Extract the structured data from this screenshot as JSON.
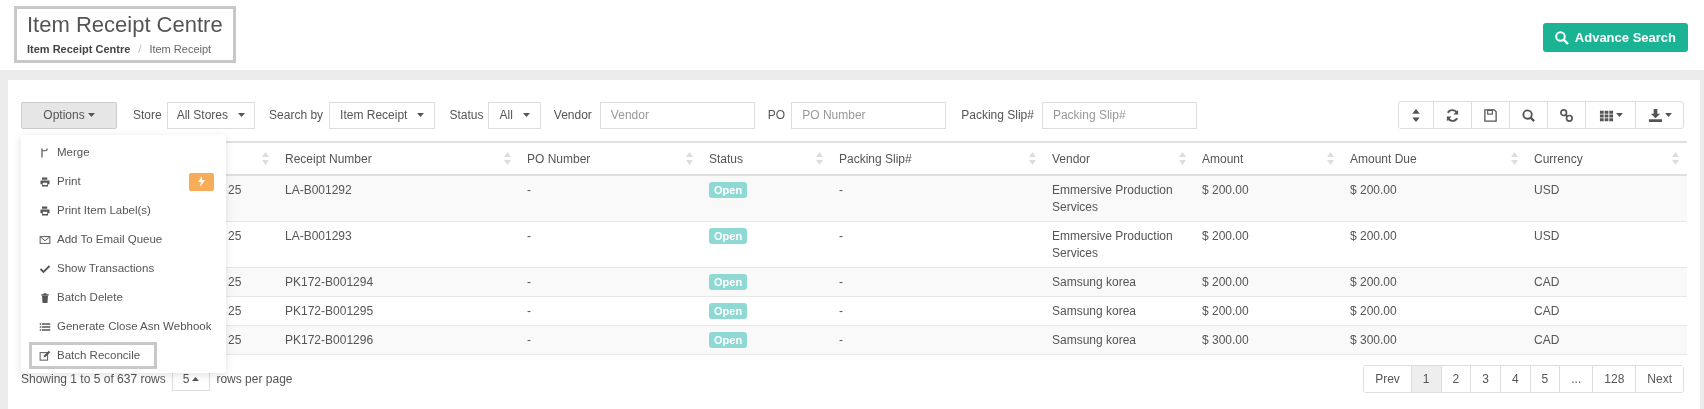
{
  "header": {
    "title": "Item Receipt Centre",
    "breadcrumb": [
      {
        "label": "Item Receipt Centre",
        "selected": false
      },
      {
        "label": "Item Receipt",
        "selected": true
      }
    ],
    "separator": "/",
    "advance_search": "Advance Search"
  },
  "filters": {
    "options": "Options",
    "store_label": "Store",
    "store": "All Stores",
    "search_by_label": "Search by",
    "search_by": "Item Receipt",
    "status_label": "Status",
    "status": "All",
    "vendor_label": "Vendor",
    "vendor_placeholder": "Vendor",
    "po_label": "PO",
    "po_placeholder": "PO Number",
    "packing_label": "Packing Slip#",
    "packing_placeholder": "Packing Slip#"
  },
  "options_menu": [
    {
      "label": "Merge",
      "highlighted": false,
      "badge": false
    },
    {
      "label": "Print",
      "highlighted": false,
      "badge": true
    },
    {
      "label": "Print Item Label(s)",
      "highlighted": false,
      "badge": false
    },
    {
      "label": "Add To Email Queue",
      "highlighted": false,
      "badge": false
    },
    {
      "label": "Show Transactions",
      "highlighted": false,
      "badge": false
    },
    {
      "label": "Batch Delete",
      "highlighted": false,
      "badge": false
    },
    {
      "label": "Generate Close Asn Webhook",
      "highlighted": false,
      "badge": false
    },
    {
      "label": "Batch Reconcile",
      "highlighted": true,
      "badge": false
    }
  ],
  "table": {
    "columns": [
      "",
      "Receipt Number",
      "PO Number",
      "Status",
      "Packing Slip#",
      "Vendor",
      "Amount",
      "Amount Due",
      "Currency"
    ],
    "rows": [
      [
        "25",
        "LA-B001292",
        "-",
        "Open",
        "-",
        "Emmersive Production Services",
        "$ 200.00",
        "$ 200.00",
        "USD"
      ],
      [
        "25",
        "LA-B001293",
        "-",
        "Open",
        "-",
        "Emmersive Production Services",
        "$ 200.00",
        "$ 200.00",
        "USD"
      ],
      [
        "25",
        "PK172-B001294",
        "-",
        "Open",
        "-",
        "Samsung korea",
        "$ 200.00",
        "$ 200.00",
        "CAD"
      ],
      [
        "25",
        "PK172-B001295",
        "-",
        "Open",
        "-",
        "Samsung korea",
        "$ 200.00",
        "$ 200.00",
        "CAD"
      ],
      [
        "25",
        "PK172-B001296",
        "-",
        "Open",
        "-",
        "Samsung korea",
        "$ 300.00",
        "$ 300.00",
        "CAD"
      ]
    ]
  },
  "footer": {
    "showing": "Showing 1 to 5 of 637 rows",
    "page_size": "5",
    "rows_per_page": "rows per page"
  },
  "pagination": [
    {
      "label": "Prev",
      "selected": false
    },
    {
      "label": "1",
      "selected": true
    },
    {
      "label": "2",
      "selected": false
    },
    {
      "label": "3",
      "selected": false
    },
    {
      "label": "4",
      "selected": false
    },
    {
      "label": "5",
      "selected": false
    },
    {
      "label": "...",
      "selected": false
    },
    {
      "label": "128",
      "selected": false
    },
    {
      "label": "Next",
      "selected": false
    }
  ]
}
